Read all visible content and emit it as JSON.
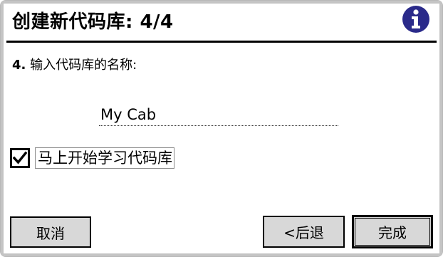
{
  "dialog": {
    "title": "创建新代码库: 4/4",
    "info_icon": "info-icon",
    "prompt_number": "4.",
    "prompt_text": " 输入代码库的名称:",
    "name_value": "My Cab",
    "checkbox_checked": true,
    "checkbox_label": "马上开始学习代码库"
  },
  "buttons": {
    "cancel": "取消",
    "back": "<后退",
    "finish": "完成"
  },
  "colors": {
    "info_icon": "#2a2a8a",
    "button_face": "#d8d8d8",
    "frame": "#c4c4c4"
  }
}
